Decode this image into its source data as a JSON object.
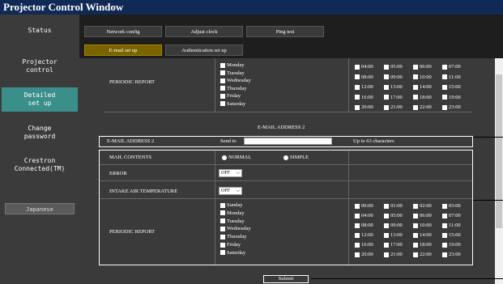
{
  "title": "Projector Control Window",
  "sidebar": {
    "status": "Status",
    "projector_control_1": "Projector",
    "projector_control_2": "control",
    "detailed_1": "Detailed",
    "detailed_2": "set up",
    "change_1": "Change",
    "change_2": "password",
    "crestron_1": "Crestron",
    "crestron_2": "Connected(TM)",
    "language": "Japanese"
  },
  "tabs": {
    "network_config": "Network config",
    "adjust_clock": "Adjust clock",
    "ping_test": "Ping test",
    "email_setup": "E-mail set up",
    "auth_setup": "Authentication set up"
  },
  "top_section": {
    "periodic_report_label": "PERIODIC REPORT",
    "days": [
      "Monday",
      "Tuesday",
      "Wednesday",
      "Thursday",
      "Friday",
      "Saturday"
    ],
    "times": [
      [
        "04:00",
        "05:00",
        "06:00",
        "07:00"
      ],
      [
        "08:00",
        "09:00",
        "10:00",
        "11:00"
      ],
      [
        "12:00",
        "13:00",
        "14:00",
        "15:00"
      ],
      [
        "16:00",
        "17:00",
        "18:00",
        "19:00"
      ],
      [
        "20:00",
        "21:00",
        "22:00",
        "23:00"
      ]
    ]
  },
  "email2": {
    "heading": "E-MAIL ADDRESS 2",
    "label": "E-MAIL ADDRESS 2",
    "send_to": "Send to",
    "input_value": "",
    "hint": "Up to 63 characters"
  },
  "settings": {
    "mail_contents_label": "MAIL CONTENTS",
    "normal": "NORMAL",
    "simple": "SIMPLE",
    "error_label": "ERROR",
    "error_value": "OFF",
    "intake_label": "INTAKE AIR TEMPERATURE",
    "intake_value": "OFF",
    "periodic_report_label": "PERIODIC REPORT",
    "days": [
      "Sunday",
      "Monday",
      "Tuesday",
      "Wednesday",
      "Thursday",
      "Friday",
      "Saturday"
    ],
    "times": [
      [
        "00:00",
        "01:00",
        "02:00",
        "03:00"
      ],
      [
        "04:00",
        "05:00",
        "06:00",
        "07:00"
      ],
      [
        "08:00",
        "09:00",
        "10:00",
        "11:00"
      ],
      [
        "12:00",
        "13:00",
        "14:00",
        "15:00"
      ],
      [
        "16:00",
        "17:00",
        "18:00",
        "19:00"
      ],
      [
        "20:00",
        "21:00",
        "22:00",
        "23:00"
      ]
    ]
  },
  "submit_label": "Submit",
  "colors": {
    "titlebar": "#102a55",
    "active_sidebar": "#3b8f8a",
    "active_tab": "#7a6400"
  }
}
